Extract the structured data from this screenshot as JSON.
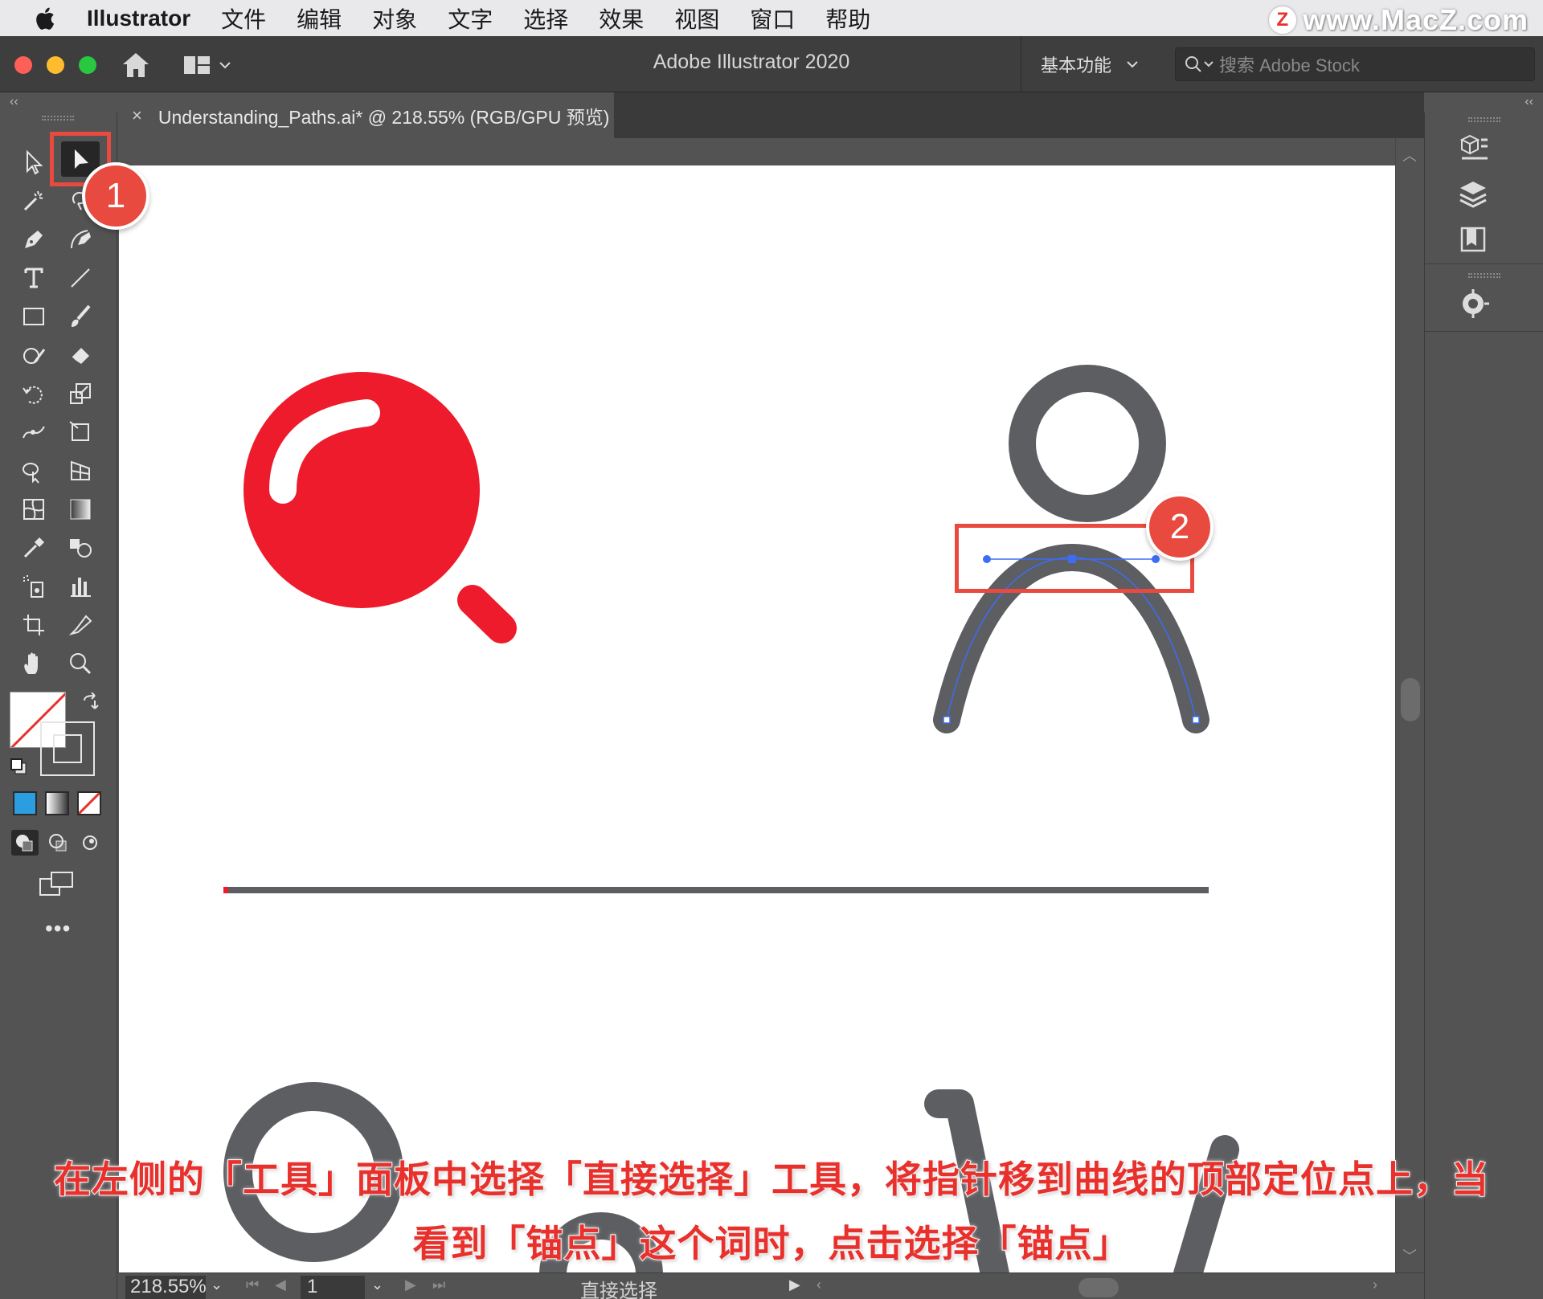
{
  "menubar": {
    "app_name": "Illustrator",
    "items": [
      "文件",
      "编辑",
      "对象",
      "文字",
      "选择",
      "效果",
      "视图",
      "窗口",
      "帮助"
    ],
    "watermark": "www.MacZ.com",
    "watermark_logo": "Z"
  },
  "titlebar": {
    "title": "Adobe Illustrator 2020",
    "workspace": "基本功能",
    "search_placeholder": "搜索 Adobe Stock"
  },
  "document_tab": {
    "title": "Understanding_Paths.ai* @ 218.55% (RGB/GPU 预览)",
    "close": "×"
  },
  "statusbar": {
    "zoom": "218.55%",
    "page": "1",
    "current_tool": "直接选择"
  },
  "annotations": {
    "badge1": "1",
    "badge2": "2"
  },
  "caption": {
    "line1": "在左侧的「工具」面板中选择「直接选择」工具，将指针移到曲线的顶部定位点上，当",
    "line2": "看到「锚点」这个词时，点击选择「锚点」"
  },
  "colors": {
    "accent_red": "#e8312c",
    "annotation_red": "#e84a3f",
    "path_gray": "#5c5e62",
    "ball_red": "#ed1b2b",
    "selection_blue": "#3d6df2"
  }
}
